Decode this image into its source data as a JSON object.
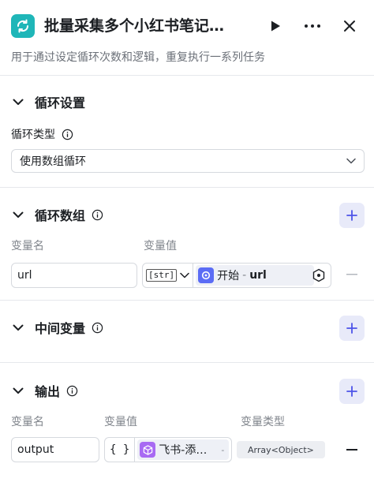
{
  "header": {
    "title": "批量采集多个小红书笔记…",
    "description": "用于通过设定循环次数和逻辑，重复执行一系列任务",
    "node_icon": "loop-icon",
    "run_icon": "play-icon",
    "more_icon": "more-icon",
    "close_icon": "close-icon"
  },
  "loop_settings": {
    "title": "循环设置",
    "type_label": "循环类型",
    "type_value": "使用数组循环"
  },
  "loop_array": {
    "title": "循环数组",
    "col_name": "变量名",
    "col_value": "变量值",
    "rows": [
      {
        "name": "url",
        "type_tag": "[str]",
        "ref_node": "开始",
        "ref_sep": "-",
        "ref_var": "url"
      }
    ]
  },
  "intermediate": {
    "title": "中间变量"
  },
  "output": {
    "title": "输出",
    "col_name": "变量名",
    "col_value": "变量值",
    "col_type": "变量类型",
    "rows": [
      {
        "name": "output",
        "brace": "{ }",
        "ref_node": "飞书-添…",
        "ref_sep": "-",
        "type": "Array<Object>"
      }
    ]
  },
  "colors": {
    "accent": "#1fb6b8",
    "add_button_bg": "#e8eaf9",
    "add_button_icon": "#4d53e8",
    "start_icon": "#5b6cf5",
    "feishu_icon": "#a86af3"
  }
}
